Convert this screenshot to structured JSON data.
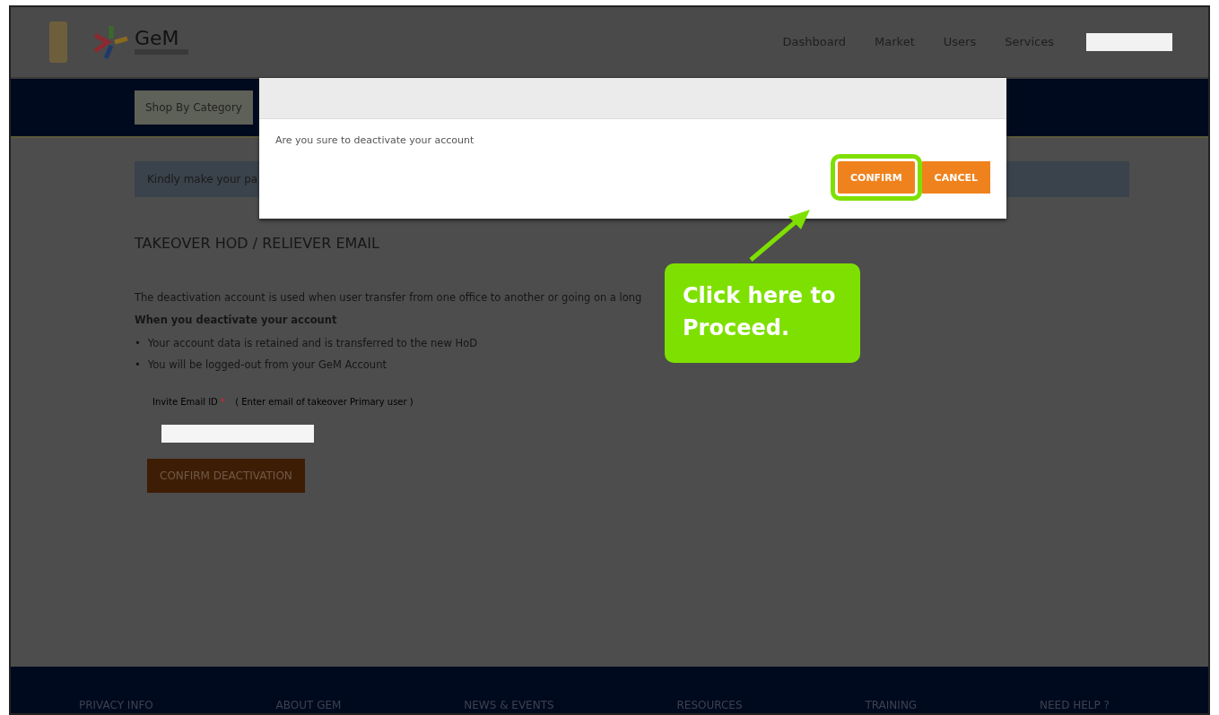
{
  "header": {
    "logo_text": "GeM",
    "nav": [
      "Dashboard",
      "Market",
      "Users",
      "Services"
    ]
  },
  "category_button": "Shop By Category",
  "alert": "Kindly make your pa",
  "section": {
    "title": "TAKEOVER HOD / RELIEVER EMAIL",
    "description": "The deactivation account is used when user transfer from one office to another or going on a long",
    "subheading": "When you deactivate your account",
    "bullet_marker": "•",
    "bullets": [
      "Your account data is retained and is transferred to the new HoD",
      "You will be logged-out from your GeM Account"
    ],
    "field_label": "Invite Email ID",
    "required_mark": "*",
    "field_hint": "( Enter email of takeover Primary user )",
    "submit": "CONFIRM DEACTIVATION"
  },
  "dialog": {
    "message": "Are you sure to deactivate your account",
    "buttons": [
      {
        "label": "CONFIRM",
        "highlighted": true
      },
      {
        "label": "CANCEL",
        "highlighted": false
      }
    ]
  },
  "callout": "Click here to Proceed.",
  "footer": [
    "PRIVACY INFO",
    "ABOUT GEM",
    "NEWS & EVENTS",
    "RESOURCES",
    "TRAINING",
    "NEED HELP ?"
  ]
}
